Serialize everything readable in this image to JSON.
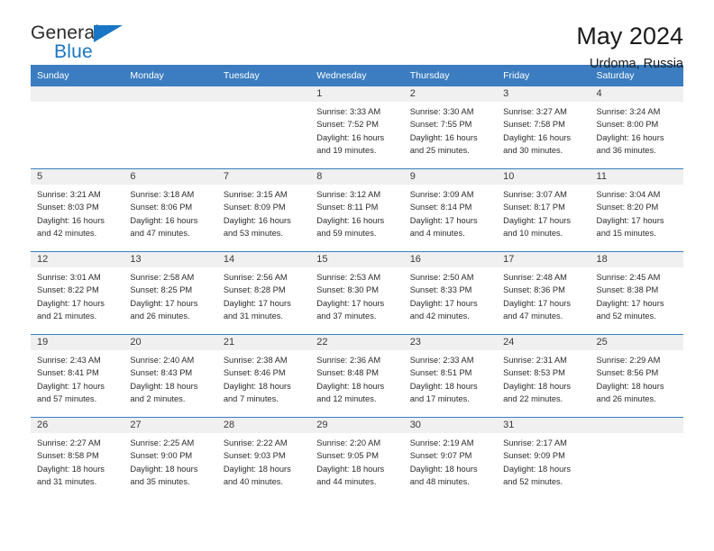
{
  "brand": {
    "word1": "General",
    "word2": "Blue",
    "accent_color": "#1a76c4",
    "triangle_icon": "triangle-icon"
  },
  "header": {
    "title": "May 2024",
    "subtitle": "Urdoma, Russia"
  },
  "calendar": {
    "header_bg": "#3b7dc0",
    "daynum_band_bg": "#f0f0f0",
    "weekday_headers": [
      "Sunday",
      "Monday",
      "Tuesday",
      "Wednesday",
      "Thursday",
      "Friday",
      "Saturday"
    ],
    "labels": {
      "sunrise": "Sunrise:",
      "sunset": "Sunset:",
      "daylight": "Daylight:"
    },
    "weeks": [
      [
        {
          "day": ""
        },
        {
          "day": ""
        },
        {
          "day": ""
        },
        {
          "day": "1",
          "sunrise": "Sunrise: 3:33 AM",
          "sunset": "Sunset: 7:52 PM",
          "daylight_line1": "Daylight: 16 hours",
          "daylight_line2": "and 19 minutes."
        },
        {
          "day": "2",
          "sunrise": "Sunrise: 3:30 AM",
          "sunset": "Sunset: 7:55 PM",
          "daylight_line1": "Daylight: 16 hours",
          "daylight_line2": "and 25 minutes."
        },
        {
          "day": "3",
          "sunrise": "Sunrise: 3:27 AM",
          "sunset": "Sunset: 7:58 PM",
          "daylight_line1": "Daylight: 16 hours",
          "daylight_line2": "and 30 minutes."
        },
        {
          "day": "4",
          "sunrise": "Sunrise: 3:24 AM",
          "sunset": "Sunset: 8:00 PM",
          "daylight_line1": "Daylight: 16 hours",
          "daylight_line2": "and 36 minutes."
        }
      ],
      [
        {
          "day": "5",
          "sunrise": "Sunrise: 3:21 AM",
          "sunset": "Sunset: 8:03 PM",
          "daylight_line1": "Daylight: 16 hours",
          "daylight_line2": "and 42 minutes."
        },
        {
          "day": "6",
          "sunrise": "Sunrise: 3:18 AM",
          "sunset": "Sunset: 8:06 PM",
          "daylight_line1": "Daylight: 16 hours",
          "daylight_line2": "and 47 minutes."
        },
        {
          "day": "7",
          "sunrise": "Sunrise: 3:15 AM",
          "sunset": "Sunset: 8:09 PM",
          "daylight_line1": "Daylight: 16 hours",
          "daylight_line2": "and 53 minutes."
        },
        {
          "day": "8",
          "sunrise": "Sunrise: 3:12 AM",
          "sunset": "Sunset: 8:11 PM",
          "daylight_line1": "Daylight: 16 hours",
          "daylight_line2": "and 59 minutes."
        },
        {
          "day": "9",
          "sunrise": "Sunrise: 3:09 AM",
          "sunset": "Sunset: 8:14 PM",
          "daylight_line1": "Daylight: 17 hours",
          "daylight_line2": "and 4 minutes."
        },
        {
          "day": "10",
          "sunrise": "Sunrise: 3:07 AM",
          "sunset": "Sunset: 8:17 PM",
          "daylight_line1": "Daylight: 17 hours",
          "daylight_line2": "and 10 minutes."
        },
        {
          "day": "11",
          "sunrise": "Sunrise: 3:04 AM",
          "sunset": "Sunset: 8:20 PM",
          "daylight_line1": "Daylight: 17 hours",
          "daylight_line2": "and 15 minutes."
        }
      ],
      [
        {
          "day": "12",
          "sunrise": "Sunrise: 3:01 AM",
          "sunset": "Sunset: 8:22 PM",
          "daylight_line1": "Daylight: 17 hours",
          "daylight_line2": "and 21 minutes."
        },
        {
          "day": "13",
          "sunrise": "Sunrise: 2:58 AM",
          "sunset": "Sunset: 8:25 PM",
          "daylight_line1": "Daylight: 17 hours",
          "daylight_line2": "and 26 minutes."
        },
        {
          "day": "14",
          "sunrise": "Sunrise: 2:56 AM",
          "sunset": "Sunset: 8:28 PM",
          "daylight_line1": "Daylight: 17 hours",
          "daylight_line2": "and 31 minutes."
        },
        {
          "day": "15",
          "sunrise": "Sunrise: 2:53 AM",
          "sunset": "Sunset: 8:30 PM",
          "daylight_line1": "Daylight: 17 hours",
          "daylight_line2": "and 37 minutes."
        },
        {
          "day": "16",
          "sunrise": "Sunrise: 2:50 AM",
          "sunset": "Sunset: 8:33 PM",
          "daylight_line1": "Daylight: 17 hours",
          "daylight_line2": "and 42 minutes."
        },
        {
          "day": "17",
          "sunrise": "Sunrise: 2:48 AM",
          "sunset": "Sunset: 8:36 PM",
          "daylight_line1": "Daylight: 17 hours",
          "daylight_line2": "and 47 minutes."
        },
        {
          "day": "18",
          "sunrise": "Sunrise: 2:45 AM",
          "sunset": "Sunset: 8:38 PM",
          "daylight_line1": "Daylight: 17 hours",
          "daylight_line2": "and 52 minutes."
        }
      ],
      [
        {
          "day": "19",
          "sunrise": "Sunrise: 2:43 AM",
          "sunset": "Sunset: 8:41 PM",
          "daylight_line1": "Daylight: 17 hours",
          "daylight_line2": "and 57 minutes."
        },
        {
          "day": "20",
          "sunrise": "Sunrise: 2:40 AM",
          "sunset": "Sunset: 8:43 PM",
          "daylight_line1": "Daylight: 18 hours",
          "daylight_line2": "and 2 minutes."
        },
        {
          "day": "21",
          "sunrise": "Sunrise: 2:38 AM",
          "sunset": "Sunset: 8:46 PM",
          "daylight_line1": "Daylight: 18 hours",
          "daylight_line2": "and 7 minutes."
        },
        {
          "day": "22",
          "sunrise": "Sunrise: 2:36 AM",
          "sunset": "Sunset: 8:48 PM",
          "daylight_line1": "Daylight: 18 hours",
          "daylight_line2": "and 12 minutes."
        },
        {
          "day": "23",
          "sunrise": "Sunrise: 2:33 AM",
          "sunset": "Sunset: 8:51 PM",
          "daylight_line1": "Daylight: 18 hours",
          "daylight_line2": "and 17 minutes."
        },
        {
          "day": "24",
          "sunrise": "Sunrise: 2:31 AM",
          "sunset": "Sunset: 8:53 PM",
          "daylight_line1": "Daylight: 18 hours",
          "daylight_line2": "and 22 minutes."
        },
        {
          "day": "25",
          "sunrise": "Sunrise: 2:29 AM",
          "sunset": "Sunset: 8:56 PM",
          "daylight_line1": "Daylight: 18 hours",
          "daylight_line2": "and 26 minutes."
        }
      ],
      [
        {
          "day": "26",
          "sunrise": "Sunrise: 2:27 AM",
          "sunset": "Sunset: 8:58 PM",
          "daylight_line1": "Daylight: 18 hours",
          "daylight_line2": "and 31 minutes."
        },
        {
          "day": "27",
          "sunrise": "Sunrise: 2:25 AM",
          "sunset": "Sunset: 9:00 PM",
          "daylight_line1": "Daylight: 18 hours",
          "daylight_line2": "and 35 minutes."
        },
        {
          "day": "28",
          "sunrise": "Sunrise: 2:22 AM",
          "sunset": "Sunset: 9:03 PM",
          "daylight_line1": "Daylight: 18 hours",
          "daylight_line2": "and 40 minutes."
        },
        {
          "day": "29",
          "sunrise": "Sunrise: 2:20 AM",
          "sunset": "Sunset: 9:05 PM",
          "daylight_line1": "Daylight: 18 hours",
          "daylight_line2": "and 44 minutes."
        },
        {
          "day": "30",
          "sunrise": "Sunrise: 2:19 AM",
          "sunset": "Sunset: 9:07 PM",
          "daylight_line1": "Daylight: 18 hours",
          "daylight_line2": "and 48 minutes."
        },
        {
          "day": "31",
          "sunrise": "Sunrise: 2:17 AM",
          "sunset": "Sunset: 9:09 PM",
          "daylight_line1": "Daylight: 18 hours",
          "daylight_line2": "and 52 minutes."
        },
        {
          "day": ""
        }
      ]
    ]
  }
}
